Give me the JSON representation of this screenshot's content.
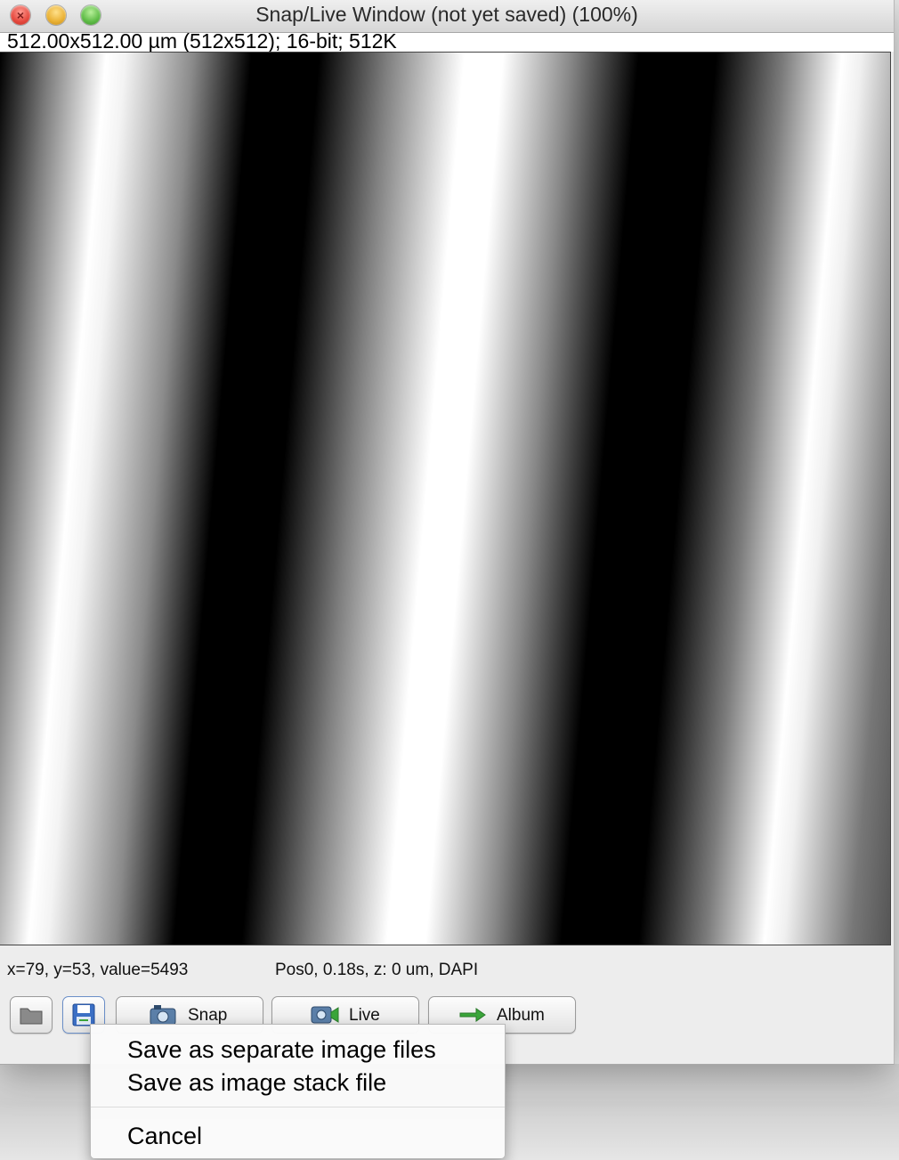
{
  "window": {
    "title": "Snap/Live Window (not yet saved) (100%)",
    "image_info": "512.00x512.00 µm (512x512); 16-bit; 512K"
  },
  "status": {
    "cursor_readout": "x=79, y=53, value=5493",
    "position_info": "Pos0, 0.18s, z: 0 um, DAPI"
  },
  "toolbar": {
    "open_icon": "folder-icon",
    "save_icon": "floppy-disk-icon",
    "snap_label": "Snap",
    "live_label": "Live",
    "album_label": "Album"
  },
  "save_menu": {
    "items": [
      {
        "label": "Save as separate image files"
      },
      {
        "label": "Save as image stack file"
      }
    ],
    "cancel_label": "Cancel"
  },
  "colors": {
    "album_arrow": "#3aa53a",
    "save_icon_blue": "#3b6fc4"
  }
}
